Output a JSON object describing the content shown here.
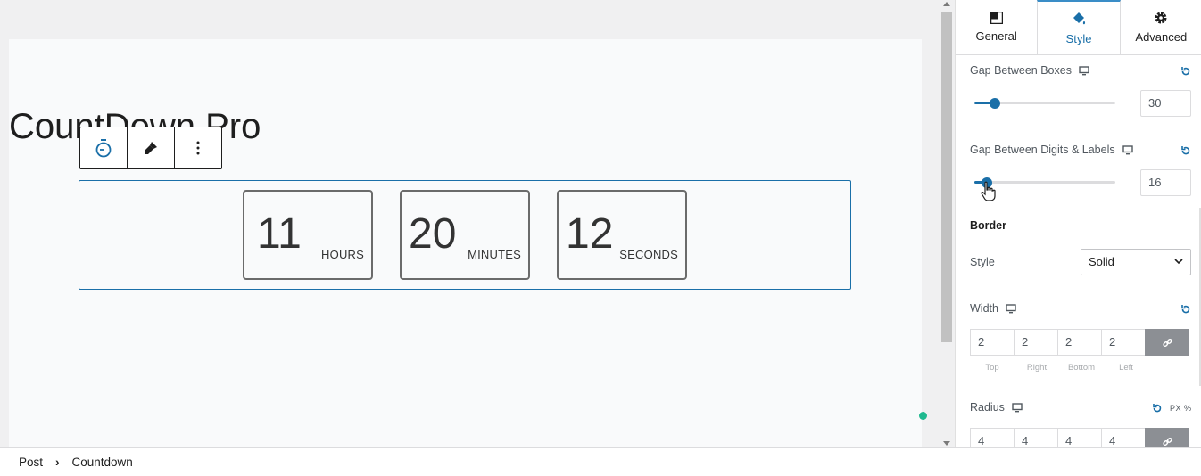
{
  "editor": {
    "post_title": "CountDown Pro",
    "toolbar": {
      "block_icon": "timer-icon",
      "style_icon": "brush-icon",
      "more_icon": "more-options-icon"
    },
    "countdown": [
      {
        "value": "11",
        "label": "HOURS"
      },
      {
        "value": "20",
        "label": "MINUTES"
      },
      {
        "value": "12",
        "label": "SECONDS"
      }
    ]
  },
  "sidebar": {
    "tabs": [
      {
        "label": "General",
        "icon": "layout-icon",
        "active": false
      },
      {
        "label": "Style",
        "icon": "paint-bucket-icon",
        "active": true
      },
      {
        "label": "Advanced",
        "icon": "gear-icon",
        "active": false
      }
    ],
    "gap_boxes": {
      "label": "Gap Between Boxes",
      "value": "30",
      "slider_fraction": 0.15
    },
    "gap_digits": {
      "label": "Gap Between Digits & Labels",
      "value": "16",
      "slider_fraction": 0.09
    },
    "border": {
      "heading": "Border",
      "style_label": "Style",
      "style_value": "Solid",
      "width_label": "Width",
      "width_values": [
        "2",
        "2",
        "2",
        "2"
      ],
      "side_labels": [
        "Top",
        "Right",
        "Bottom",
        "Left"
      ],
      "radius_label": "Radius",
      "radius_units": "PX %",
      "radius_values": [
        "4",
        "4",
        "4",
        "4"
      ]
    }
  },
  "breadcrumb": {
    "items": [
      "Post",
      "Countdown"
    ],
    "separator": "›"
  },
  "colors": {
    "accent": "#1a6fa8",
    "indicator": "#1fb98f"
  }
}
